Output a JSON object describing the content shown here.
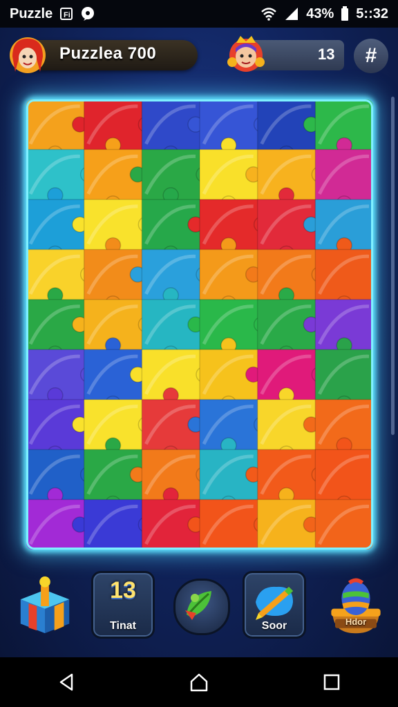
{
  "status_bar": {
    "app_label": "Puzzle",
    "battery": "43%",
    "time": "5::32",
    "icons": [
      "gallery-icon",
      "chat-icon",
      "wifi-icon",
      "signal-icon",
      "battery-icon"
    ]
  },
  "header": {
    "player_name": "Puzzlea 700",
    "score": "13",
    "menu_symbol": "#"
  },
  "board": {
    "columns": 6,
    "rows": 9,
    "piece_colors": [
      [
        "#f4a11c",
        "#e0242c",
        "#2f49c9",
        "#3655d6",
        "#2243b8",
        "#2db84a"
      ],
      [
        "#2ec1c9",
        "#f6a01a",
        "#2aa846",
        "#f9e02a",
        "#f7b21e",
        "#d12a95"
      ],
      [
        "#1d9fd8",
        "#f9e22c",
        "#26a84a",
        "#e42a2a",
        "#e22a3a",
        "#2a9ed8"
      ],
      [
        "#f9d22a",
        "#f28c1a",
        "#2aa0dc",
        "#f49a1a",
        "#f27a1a",
        "#ef5a1a"
      ],
      [
        "#2aa846",
        "#f5b21c",
        "#26b6c2",
        "#2ab84a",
        "#2aaa48",
        "#7a3ad6"
      ],
      [
        "#5a4ad8",
        "#2a62d6",
        "#f9e02a",
        "#f6c21c",
        "#e01a7a",
        "#2aa24a"
      ],
      [
        "#5a3ad8",
        "#f9e22c",
        "#e63a3a",
        "#2a74d8",
        "#f8d62a",
        "#f26a1a"
      ],
      [
        "#2060c8",
        "#2aa846",
        "#f27a1a",
        "#28b4c4",
        "#f25a1a",
        "#f2541a"
      ],
      [
        "#a22ad6",
        "#3a3ad6",
        "#e2243a",
        "#f2541a",
        "#f6b21c",
        "#f2641a"
      ]
    ]
  },
  "toolbar": {
    "items": [
      {
        "name": "bonus-box",
        "label": ""
      },
      {
        "name": "time-tool",
        "number": "13",
        "label": "Tinat"
      },
      {
        "name": "leaf-hint",
        "label": ""
      },
      {
        "name": "score-tool",
        "label": "Soor"
      },
      {
        "name": "egg-shop",
        "label": "Hdor"
      }
    ]
  }
}
